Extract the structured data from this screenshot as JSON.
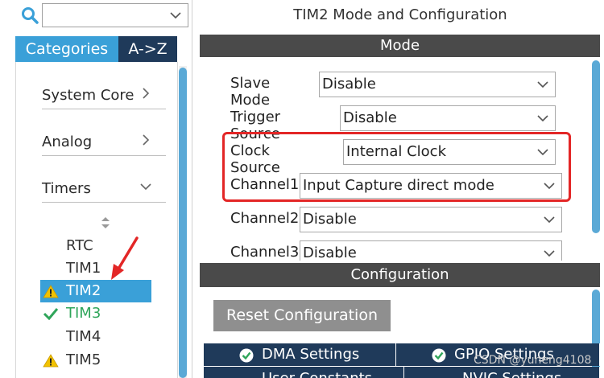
{
  "search": {
    "value": ""
  },
  "tabs": {
    "categories": "Categories",
    "az": "A->Z"
  },
  "categories": [
    {
      "label": "System Core",
      "chevron": "chevron-right"
    },
    {
      "label": "Analog",
      "chevron": "chevron-right"
    },
    {
      "label": "Timers",
      "chevron": "chevron-down"
    }
  ],
  "peripherals": [
    {
      "label": "RTC",
      "status": "none"
    },
    {
      "label": "TIM1",
      "status": "none"
    },
    {
      "label": "TIM2",
      "status": "warning",
      "selected": true
    },
    {
      "label": "TIM3",
      "status": "ok"
    },
    {
      "label": "TIM4",
      "status": "none"
    },
    {
      "label": "TIM5",
      "status": "warning"
    }
  ],
  "main": {
    "title": "TIM2 Mode and Configuration",
    "mode_header": "Mode",
    "config_header": "Configuration",
    "reset_button": "Reset Configuration"
  },
  "fields": [
    {
      "label": "Slave Mode",
      "value": "Disable"
    },
    {
      "label": "Trigger Source",
      "value": "Disable"
    },
    {
      "label": "Clock Source",
      "value": "Internal Clock"
    },
    {
      "label": "Channel1",
      "value": "Input Capture direct mode"
    },
    {
      "label": "Channel2",
      "value": "Disable"
    },
    {
      "label": "Channel3",
      "value": "Disable"
    }
  ],
  "config_tabs": [
    {
      "label": "DMA Settings"
    },
    {
      "label": "GPIO Settings"
    },
    {
      "label": "User Constants"
    },
    {
      "label": "NVIC Settings"
    }
  ],
  "watermark": "CSDN @yuheng4108",
  "colors": {
    "accent": "#3aa0d8",
    "dark_tab": "#1f3a5a",
    "header": "#4a4a4a",
    "highlight": "#e32626",
    "ok": "#2fa55a",
    "warning": "#f2c200"
  }
}
